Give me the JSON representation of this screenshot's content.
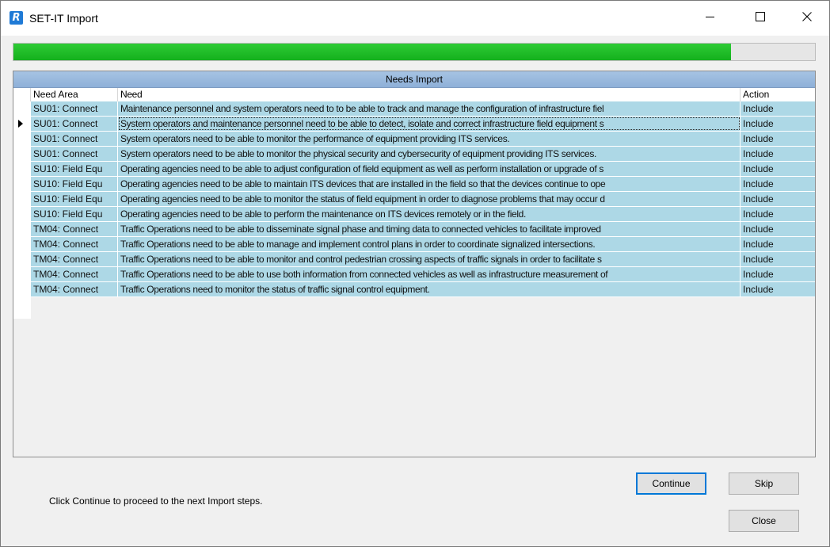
{
  "window": {
    "title": "SET-IT Import",
    "icon": "R",
    "minimize_icon": "minimize-icon",
    "maximize_icon": "maximize-icon",
    "close_icon": "close-icon"
  },
  "progress": {
    "fraction": 0.895,
    "color": "#14b01d"
  },
  "grid": {
    "caption": "Needs Import",
    "columns": {
      "area": "Need Area",
      "need": "Need",
      "action": "Action"
    },
    "current_row": 1,
    "row_color": "#add8e6",
    "rows": [
      {
        "area": "SU01: Connect",
        "need": "Maintenance personnel and system operators need to to be able to track and manage the configuration of infrastructure fiel",
        "action": "Include"
      },
      {
        "area": "SU01: Connect",
        "need": "System operators and maintenance personnel need to be able to detect, isolate and correct infrastructure field equipment s",
        "action": "Include"
      },
      {
        "area": "SU01: Connect",
        "need": "System operators need to be able to monitor the performance of equipment providing ITS services.",
        "action": "Include"
      },
      {
        "area": "SU01: Connect",
        "need": "System operators need to be able to monitor the physical security and cybersecurity of equipment providing ITS services.",
        "action": "Include"
      },
      {
        "area": "SU10: Field Equ",
        "need": "Operating agencies need to be able to adjust configuration of field equipment as well as perform installation or upgrade of s",
        "action": "Include"
      },
      {
        "area": "SU10: Field Equ",
        "need": "Operating agencies need to be able to maintain ITS devices that are installed in the field so that the devices continue to ope",
        "action": "Include"
      },
      {
        "area": "SU10: Field Equ",
        "need": "Operating agencies need to be able to monitor the status of field equipment in order to diagnose problems that may occur d",
        "action": "Include"
      },
      {
        "area": "SU10: Field Equ",
        "need": "Operating agencies need to be able to perform the maintenance on ITS devices remotely or in the field.",
        "action": "Include"
      },
      {
        "area": "TM04: Connect",
        "need": "Traffic Operations need to be able to disseminate signal phase and timing data to connected vehicles to facilitate improved",
        "action": "Include"
      },
      {
        "area": "TM04: Connect",
        "need": "Traffic Operations need to be able to manage and implement control plans in order to coordinate signalized intersections.",
        "action": "Include"
      },
      {
        "area": "TM04: Connect",
        "need": "Traffic Operations need to be able to monitor and control pedestrian crossing aspects of traffic signals in order to facilitate s",
        "action": "Include"
      },
      {
        "area": "TM04: Connect",
        "need": "Traffic Operations need to be able to use both information from connected vehicles as well as infrastructure measurement of",
        "action": "Include"
      },
      {
        "area": "TM04: Connect",
        "need": "Traffic Operations need to monitor the status of traffic signal control equipment.",
        "action": "Include"
      }
    ]
  },
  "footer": {
    "instruction": "Click Continue to proceed to the next Import steps.",
    "continue_label": "Continue",
    "skip_label": "Skip",
    "close_label": "Close"
  }
}
